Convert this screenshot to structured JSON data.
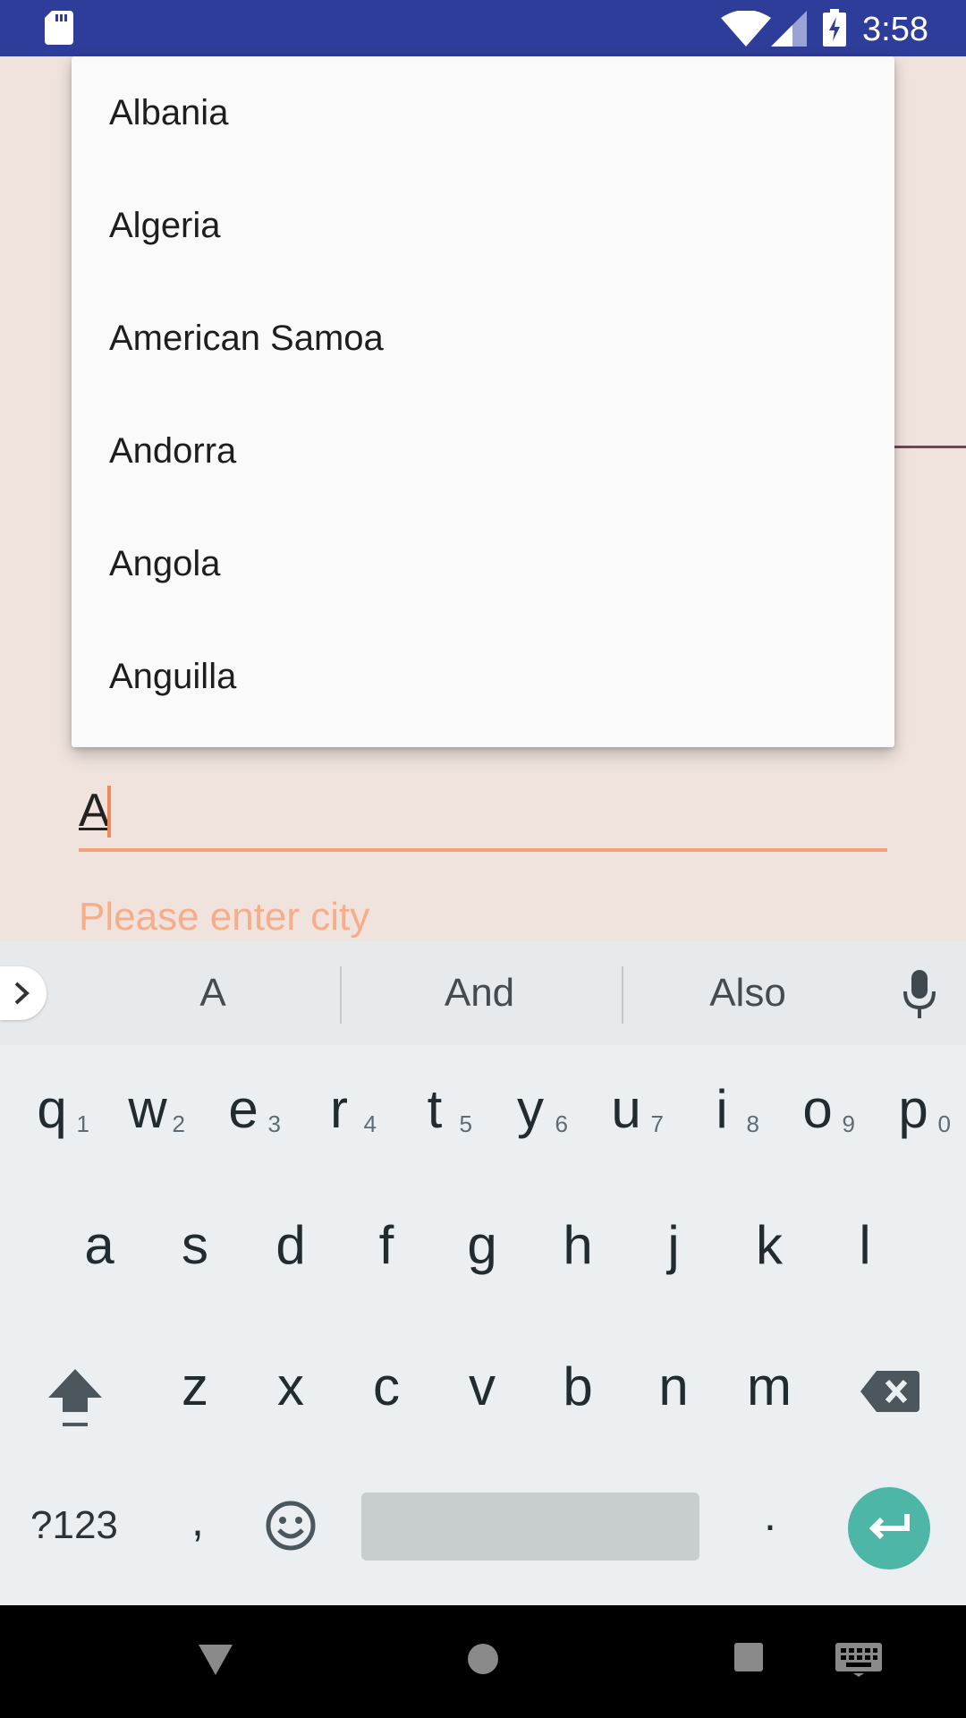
{
  "status_bar": {
    "time": "3:58",
    "icons": [
      "sd-card-icon",
      "wifi-icon",
      "signal-icon",
      "battery-charging-icon"
    ]
  },
  "dropdown": {
    "items": [
      "Albania",
      "Algeria",
      "American Samoa",
      "Andorra",
      "Angola",
      "Anguilla"
    ]
  },
  "city_field": {
    "value": "A",
    "hint": "Please enter city"
  },
  "keyboard": {
    "suggestions": [
      "A",
      "And",
      "Also"
    ],
    "row1": [
      {
        "key": "q",
        "num": "1"
      },
      {
        "key": "w",
        "num": "2"
      },
      {
        "key": "e",
        "num": "3"
      },
      {
        "key": "r",
        "num": "4"
      },
      {
        "key": "t",
        "num": "5"
      },
      {
        "key": "y",
        "num": "6"
      },
      {
        "key": "u",
        "num": "7"
      },
      {
        "key": "i",
        "num": "8"
      },
      {
        "key": "o",
        "num": "9"
      },
      {
        "key": "p",
        "num": "0"
      }
    ],
    "row2": [
      "a",
      "s",
      "d",
      "f",
      "g",
      "h",
      "j",
      "k",
      "l"
    ],
    "row3": [
      "z",
      "x",
      "c",
      "v",
      "b",
      "n",
      "m"
    ],
    "symbols_label": "?123",
    "comma": ",",
    "period": "."
  },
  "colors": {
    "status_bar": "#2f3d9a",
    "accent": "#f4a27c",
    "enter": "#4db6a6"
  }
}
